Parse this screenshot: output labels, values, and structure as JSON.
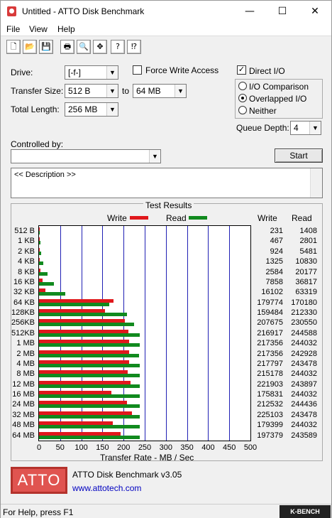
{
  "window": {
    "title": "Untitled - ATTO Disk Benchmark",
    "minimize": "—",
    "maximize": "☐",
    "close": "✕"
  },
  "menu": [
    "File",
    "View",
    "Help"
  ],
  "toolbar": [
    {
      "name": "new-icon",
      "glyph": "🗋"
    },
    {
      "name": "open-icon",
      "glyph": "📂"
    },
    {
      "name": "save-icon",
      "glyph": "💾"
    },
    {
      "name": "print-icon",
      "glyph": "🖶"
    },
    {
      "name": "print-preview-icon",
      "glyph": "🔍"
    },
    {
      "name": "move-icon",
      "glyph": "✥"
    },
    {
      "name": "help-icon",
      "glyph": "?"
    },
    {
      "name": "context-help-icon",
      "glyph": "⁉"
    }
  ],
  "form": {
    "drive_label": "Drive:",
    "drive_value": "[-f-]",
    "transfer_size_label": "Transfer Size:",
    "transfer_from": "512 B",
    "to_label": "to",
    "transfer_to": "64 MB",
    "total_length_label": "Total Length:",
    "total_length": "256 MB",
    "force_write_label": "Force Write Access",
    "force_write_checked": false,
    "direct_io_label": "Direct I/O",
    "direct_io_checked": true,
    "io_comparison_label": "I/O Comparison",
    "overlapped_io_label": "Overlapped I/O",
    "neither_label": "Neither",
    "selected_mode": "Overlapped I/O",
    "queue_depth_label": "Queue Depth:",
    "queue_depth": "4",
    "controlled_by_label": "Controlled by:",
    "controlled_by_value": "",
    "start_label": "Start",
    "description": "<< Description >>"
  },
  "results": {
    "group_title": "Test Results",
    "legend_write": "Write",
    "legend_read": "Read",
    "col_write": "Write",
    "col_read": "Read",
    "colors": {
      "write": "#e0181c",
      "read": "#118a1e",
      "grid": "#1f1fb4"
    }
  },
  "chart_data": {
    "type": "bar",
    "orientation": "horizontal",
    "xlabel": "Transfer Rate - MB / Sec",
    "xlim": [
      0,
      500
    ],
    "xticks": [
      0,
      50,
      100,
      150,
      200,
      250,
      300,
      350,
      400,
      450,
      500
    ],
    "grid": true,
    "legend_position": "top",
    "categories": [
      "512 B",
      "1 KB",
      "2 KB",
      "4 KB",
      "8 KB",
      "16 KB",
      "32 KB",
      "64 KB",
      "128KB",
      "256KB",
      "512KB",
      "1 MB",
      "2 MB",
      "4 MB",
      "8 MB",
      "12 MB",
      "16 MB",
      "24 MB",
      "32 MB",
      "48 MB",
      "64 MB"
    ],
    "series": [
      {
        "name": "Write",
        "values_kb": [
          231,
          467,
          924,
          1325,
          2584,
          7858,
          16102,
          179774,
          159484,
          207675,
          216917,
          217356,
          217356,
          217797,
          215178,
          221903,
          175831,
          212532,
          225103,
          179399,
          197379
        ]
      },
      {
        "name": "Read",
        "values_kb": [
          1408,
          2801,
          5481,
          10830,
          20177,
          36817,
          63319,
          170180,
          212330,
          230550,
          244588,
          244032,
          242928,
          243478,
          244032,
          243897,
          244032,
          244436,
          243478,
          244032,
          243589
        ]
      }
    ]
  },
  "footer": {
    "logo": "ATTO",
    "product": "ATTO Disk Benchmark v3.05",
    "url": "www.attotech.com",
    "status": "For Help, press F1",
    "badge": "K-BENCH"
  }
}
